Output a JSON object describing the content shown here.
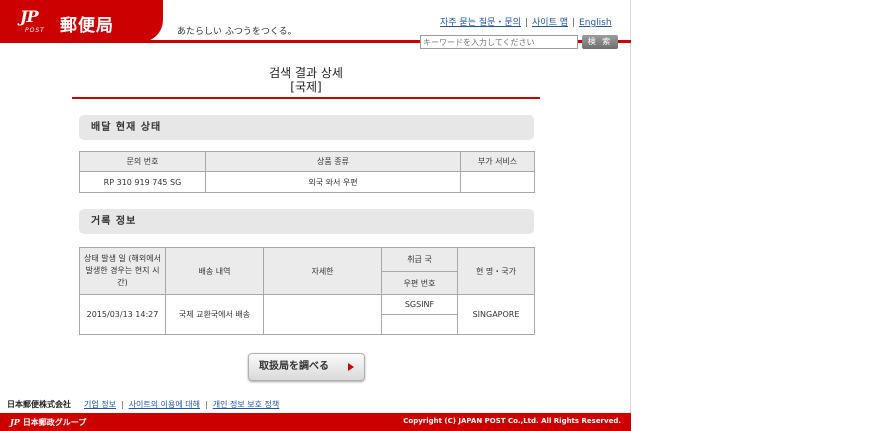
{
  "header": {
    "logo_mark": "JP",
    "logo_post": "POST",
    "logo_name": "郵便局",
    "tagline": "あたらしい ふつうをつくる。",
    "links": [
      "자주 묻는 질문・문의",
      "사이트 맵",
      "English"
    ],
    "search_placeholder": "キーワードを入力してください",
    "search_button": "検 索"
  },
  "title": {
    "line1": "검색 결과 상세",
    "line2": "[국제]"
  },
  "delivery_section": {
    "heading": "배달 현재 상태",
    "columns": [
      "문의 번호",
      "상품 종류",
      "부가 서비스"
    ],
    "row": [
      "RP 310 919 745 SG",
      "외국 와서 우편",
      ""
    ]
  },
  "history_section": {
    "heading": "거록 정보",
    "col_datetime": "상태 발생 일 (해외에서 발생한 경우는 현지 시간)",
    "col_status": "배송 내역",
    "col_detail": "자세한",
    "col_office": "취급 국",
    "col_postal": "우편 번호",
    "col_region": "현 명・국가",
    "row": {
      "datetime": "2015/03/13 14:27",
      "status": "국제 교환국에서 배송",
      "detail": "",
      "office": "SGSINF",
      "postal": "",
      "region": "SINGAPORE"
    }
  },
  "action_button": "取扱局を調べる",
  "footer": {
    "company": "日本郵便株式会社",
    "links": [
      "기업 정보",
      "사이트의 이용에 대해",
      "개인 정보 보호 정책"
    ],
    "group_mark": "JP",
    "group_name": "日本郵政グループ",
    "copyright": "Copyright (C) JAPAN POST Co.,Ltd.  All Rights Reserved."
  },
  "colors": {
    "brand_red": "#cc0000",
    "link_blue": "#2255aa",
    "table_header": "#ebebeb"
  }
}
